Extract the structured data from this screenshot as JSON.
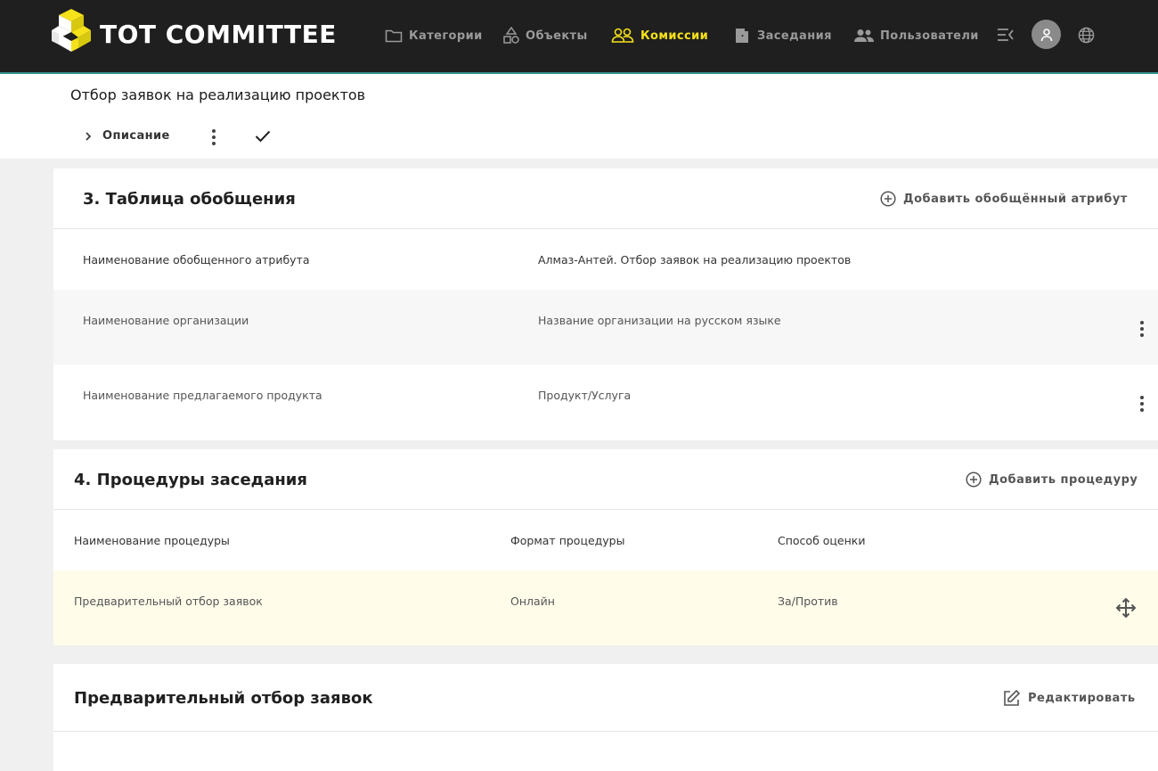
{
  "app": {
    "brand": "TOT COMMITTEE",
    "accent_color": "#f5e21b",
    "nav": [
      {
        "label": "Категории",
        "icon": "folder-icon"
      },
      {
        "label": "Объекты",
        "icon": "shapes-icon"
      },
      {
        "label": "Комиссии",
        "icon": "users-icon",
        "active": true
      },
      {
        "label": "Заседания",
        "icon": "door-icon"
      },
      {
        "label": "Пользователи",
        "icon": "people-icon"
      }
    ]
  },
  "page": {
    "title": "Отбор заявок на реализацию проектов",
    "description_label": "Описание"
  },
  "generalization": {
    "title": "3. Таблица обобщения",
    "add_label": "Добавить обобщённый атрибут",
    "rows": [
      {
        "name": "Наименование обобщенного атрибута",
        "value": "Алмаз-Антей. Отбор заявок на реализацию проектов"
      },
      {
        "name": "Наименование организации",
        "value": "Название организации на русском языке"
      },
      {
        "name": "Наименование предлагаемого продукта",
        "value": "Продукт/Услуга"
      }
    ]
  },
  "procedures": {
    "title": "4. Процедуры заседания",
    "add_label": "Добавить процедуру",
    "headers": {
      "name": "Наименование процедуры",
      "format": "Формат процедуры",
      "method": "Способ оценки"
    },
    "rows": [
      {
        "name": "Предварительный отбор заявок",
        "format": "Онлайн",
        "method": "За/Против"
      }
    ]
  },
  "procedure_detail": {
    "title": "Предварительный отбор заявок",
    "edit_label": "Редактировать"
  }
}
